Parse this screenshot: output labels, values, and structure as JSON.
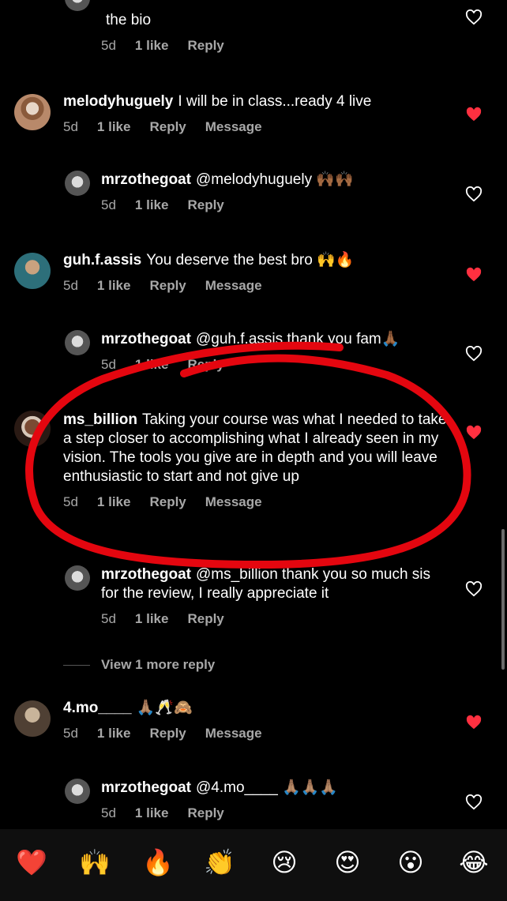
{
  "comments": [
    {
      "user": "",
      "text": "the bio",
      "meta": {
        "time": "5d",
        "likes": "1 like",
        "reply": "Reply",
        "message": ""
      },
      "liked": false
    },
    {
      "user": "melodyhuguely",
      "text": "I will be in class...ready 4 live",
      "meta": {
        "time": "5d",
        "likes": "1 like",
        "reply": "Reply",
        "message": "Message"
      },
      "liked": true
    },
    {
      "user": "mrzothegoat",
      "text": "@melodyhuguely 🙌🏾🙌🏾",
      "meta": {
        "time": "5d",
        "likes": "1 like",
        "reply": "Reply",
        "message": ""
      },
      "liked": false
    },
    {
      "user": "guh.f.assis",
      "text": "You deserve the best bro 🙌🔥",
      "meta": {
        "time": "5d",
        "likes": "1 like",
        "reply": "Reply",
        "message": "Message"
      },
      "liked": true
    },
    {
      "user": "mrzothegoat",
      "text": "@guh.f.assis thank you fam🙏🏾",
      "meta": {
        "time": "5d",
        "likes": "1 like",
        "reply": "Reply",
        "message": ""
      },
      "liked": false
    },
    {
      "user": "ms_billion",
      "text": "Taking your course was what I needed to take a step closer to accomplishing what I already seen in my vision. The tools you give are in depth and you will leave enthusiastic to start and not give up",
      "meta": {
        "time": "5d",
        "likes": "1 like",
        "reply": "Reply",
        "message": "Message"
      },
      "liked": true
    },
    {
      "user": "mrzothegoat",
      "text": "@ms_billion thank you so much sis for the review, I really appreciate it",
      "meta": {
        "time": "5d",
        "likes": "1 like",
        "reply": "Reply",
        "message": ""
      },
      "liked": false
    },
    {
      "user": "4.mo____",
      "text": "🙏🏽🥂🙈",
      "meta": {
        "time": "5d",
        "likes": "1 like",
        "reply": "Reply",
        "message": "Message"
      },
      "liked": true
    },
    {
      "user": "mrzothegoat",
      "text": "@4.mo____ 🙏🏽🙏🏽🙏🏽",
      "meta": {
        "time": "5d",
        "likes": "1 like",
        "reply": "Reply",
        "message": ""
      },
      "liked": false
    }
  ],
  "view_more": "View 1 more reply",
  "reactions": [
    "❤️",
    "🙌",
    "🔥",
    "👏",
    "😢",
    "😍",
    "😮",
    "😂"
  ],
  "colors": {
    "background": "#000000",
    "like": "#ff3040",
    "secondary": "#a8a8a8",
    "annotation": "#e4060f"
  }
}
